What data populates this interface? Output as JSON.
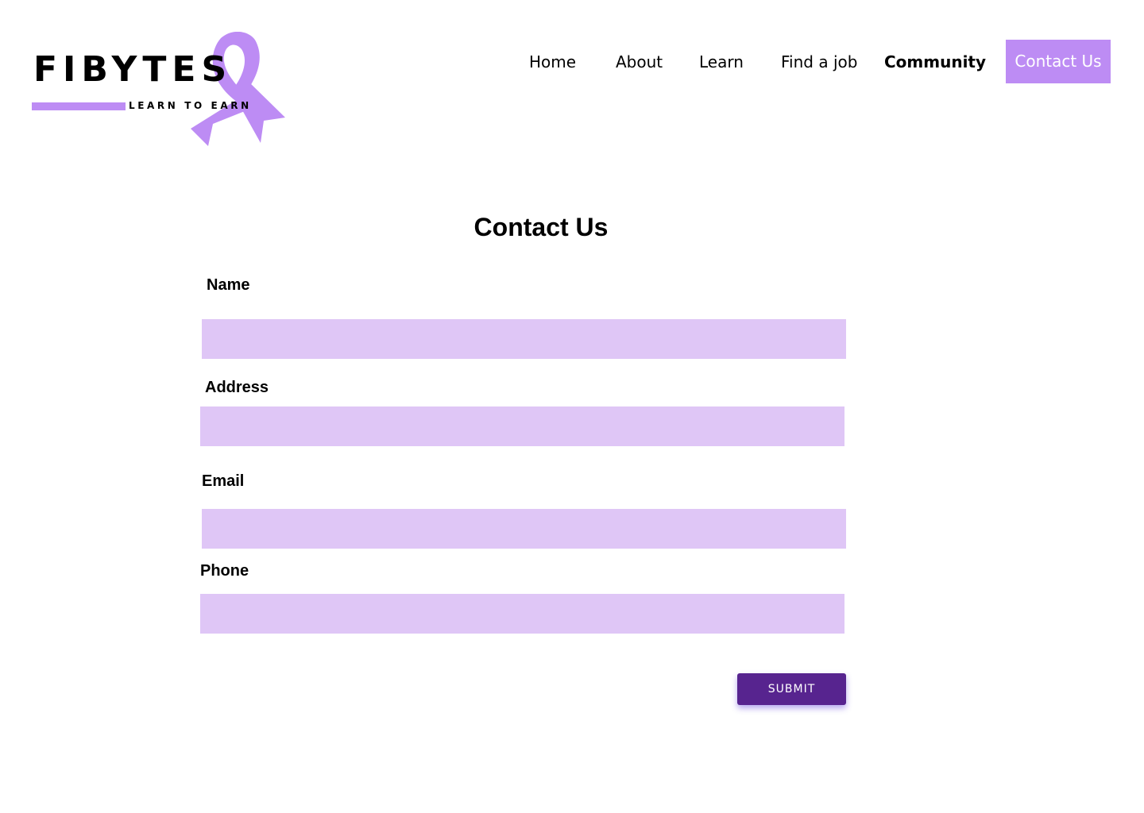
{
  "logo": {
    "brand": "FIBYTES",
    "tagline": "LEARN TO EARN",
    "ribbon_icon": "awareness-ribbon-icon",
    "ribbon_color": "#bd8cf4"
  },
  "nav": {
    "items": [
      {
        "label": "Home"
      },
      {
        "label": "About"
      },
      {
        "label": "Learn"
      },
      {
        "label": "Find a job"
      },
      {
        "label": "Community"
      }
    ],
    "cta_label": "Contact Us"
  },
  "form": {
    "title": "Contact Us",
    "fields": {
      "name": {
        "label": "Name",
        "value": "",
        "placeholder": ""
      },
      "address": {
        "label": "Address",
        "value": "",
        "placeholder": ""
      },
      "email": {
        "label": "Email",
        "value": "",
        "placeholder": ""
      },
      "phone": {
        "label": "Phone",
        "value": "",
        "placeholder": ""
      }
    },
    "submit_label": "SUBMIT"
  },
  "colors": {
    "accent": "#bd8cf4",
    "input_fill": "#dfc6f6",
    "button": "#57248f"
  }
}
